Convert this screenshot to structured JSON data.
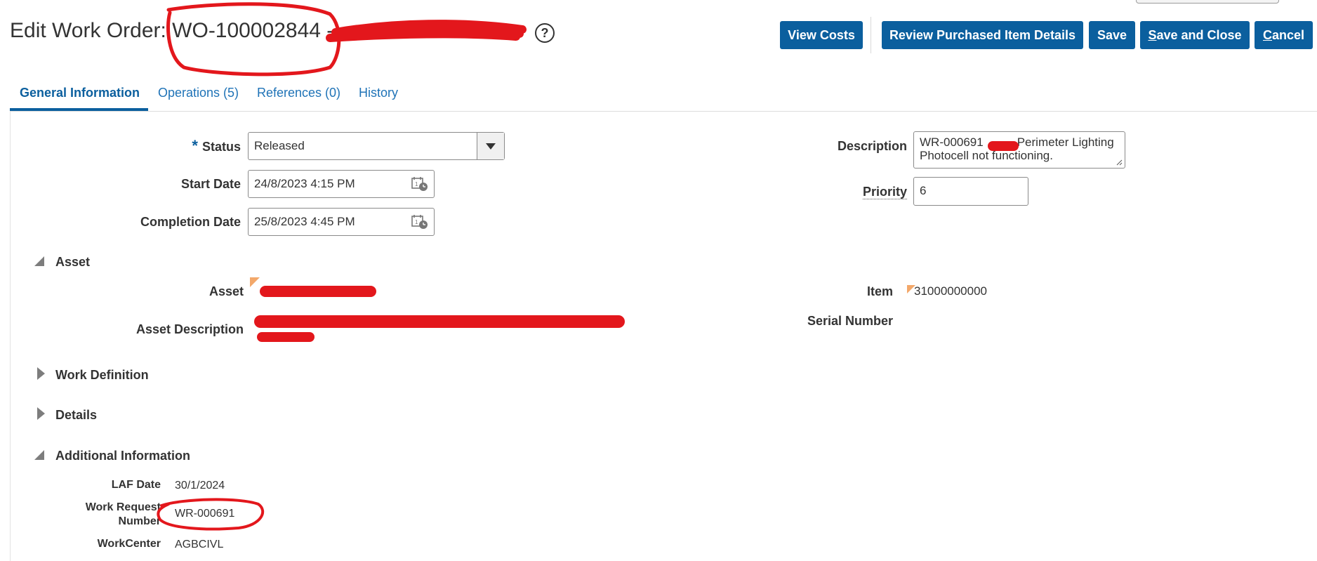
{
  "header": {
    "title": "Edit Work Order: WO-100002844 --",
    "help": "?"
  },
  "toolbar": {
    "view_costs": "View Costs",
    "review_purchased": "Review Purchased Item Details",
    "save": "Save",
    "save_and_close": "Save and Close",
    "cancel": "Cancel"
  },
  "tabs": [
    {
      "label": "General Information",
      "active": true
    },
    {
      "label": "Operations (5)"
    },
    {
      "label": "References (0)"
    },
    {
      "label": "History"
    }
  ],
  "form": {
    "status_label": "Status",
    "required_mark": "*",
    "status_value": "Released",
    "start_date_label": "Start Date",
    "start_date_value": "24/8/2023 4:15 PM",
    "completion_date_label": "Completion Date",
    "completion_date_value": "25/8/2023 4:45 PM",
    "description_label": "Description",
    "description_line1": "WR-000691",
    "description_line1b": "Perimeter Lighting",
    "description_line2": "Photocell not functioning.",
    "priority_label": "Priority",
    "priority_value": "6"
  },
  "asset_section": {
    "title": "Asset",
    "asset_label": "Asset",
    "asset_description_label": "Asset Description",
    "item_label": "Item",
    "item_value": "31000000000",
    "serial_number_label": "Serial Number"
  },
  "collapsed_sections": {
    "work_definition": "Work Definition",
    "details": "Details"
  },
  "additional_info": {
    "title": "Additional Information",
    "laf_date_label": "LAF Date",
    "laf_date_value": "30/1/2024",
    "work_request_label_1": "Work Request",
    "work_request_label_2": "Number",
    "work_request_value": "WR-000691",
    "workcenter_label": "WorkCenter",
    "workcenter_value": "AGBCIVL"
  },
  "colors": {
    "accent": "#0b5f9e",
    "link": "#1f73b7",
    "annotation": "#e3171c",
    "flag": "#f3a86a"
  }
}
